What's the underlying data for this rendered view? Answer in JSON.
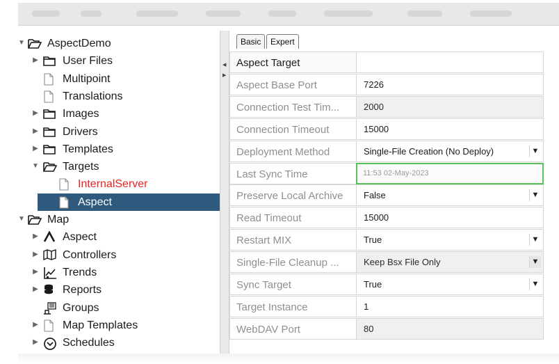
{
  "tree": {
    "items": [
      {
        "label": "AspectDemo",
        "icon": "folder-open-icon",
        "arrow": "expanded",
        "selected": false,
        "red": false
      },
      {
        "label": "User Files",
        "icon": "folder-icon",
        "arrow": "collapsed",
        "selected": false,
        "red": false
      },
      {
        "label": "Multipoint",
        "icon": "file-icon",
        "arrow": "none",
        "selected": false,
        "red": false
      },
      {
        "label": "Translations",
        "icon": "file-icon",
        "arrow": "none",
        "selected": false,
        "red": false
      },
      {
        "label": "Images",
        "icon": "folder-icon",
        "arrow": "collapsed",
        "selected": false,
        "red": false
      },
      {
        "label": "Drivers",
        "icon": "folder-icon",
        "arrow": "collapsed",
        "selected": false,
        "red": false
      },
      {
        "label": "Templates",
        "icon": "folder-icon",
        "arrow": "collapsed",
        "selected": false,
        "red": false
      },
      {
        "label": "Targets",
        "icon": "folder-open-icon",
        "arrow": "expanded",
        "selected": false,
        "red": false
      },
      {
        "label": "InternalServer",
        "icon": "file-icon",
        "arrow": "none",
        "selected": false,
        "red": true
      },
      {
        "label": "Aspect",
        "icon": "file-icon",
        "arrow": "none",
        "selected": true,
        "red": false
      },
      {
        "label": "Map",
        "icon": "folder-open-icon",
        "arrow": "expanded",
        "selected": false,
        "red": false
      },
      {
        "label": "Aspect",
        "icon": "aspect-logo-icon",
        "arrow": "collapsed",
        "selected": false,
        "red": false
      },
      {
        "label": "Controllers",
        "icon": "map-icon",
        "arrow": "collapsed",
        "selected": false,
        "red": false
      },
      {
        "label": "Trends",
        "icon": "trend-chart-icon",
        "arrow": "collapsed",
        "selected": false,
        "red": false
      },
      {
        "label": "Reports",
        "icon": "database-icon",
        "arrow": "collapsed",
        "selected": false,
        "red": false
      },
      {
        "label": "Groups",
        "icon": "groups-icon",
        "arrow": "none",
        "selected": false,
        "red": false
      },
      {
        "label": "Map Templates",
        "icon": "file-icon",
        "arrow": "collapsed",
        "selected": false,
        "red": false
      },
      {
        "label": "Schedules",
        "icon": "clock-icon",
        "arrow": "collapsed",
        "selected": false,
        "red": false
      }
    ]
  },
  "tabs": [
    {
      "label": "Basic",
      "active": false
    },
    {
      "label": "Expert",
      "active": true
    }
  ],
  "properties": {
    "header": {
      "name": "Aspect Target",
      "value": ""
    },
    "rows": [
      {
        "name": "Aspect Base Port",
        "value": "7226",
        "type": "text"
      },
      {
        "name": "Connection Test Tim...",
        "value": "2000",
        "type": "readonly"
      },
      {
        "name": "Connection Timeout",
        "value": "15000",
        "type": "text"
      },
      {
        "name": "Deployment Method",
        "value": "Single-File Creation (No Deploy)",
        "type": "dropdown"
      },
      {
        "name": "Last Sync Time",
        "value": "11:53 02-May-2023",
        "type": "sync"
      },
      {
        "name": "Preserve Local Archive",
        "value": "False",
        "type": "dropdown"
      },
      {
        "name": "Read Timeout",
        "value": "15000",
        "type": "text"
      },
      {
        "name": "Restart MIX",
        "value": "True",
        "type": "dropdown"
      },
      {
        "name": "Single-File Cleanup ...",
        "value": "Keep Bsx File Only",
        "type": "dropdown-readonly"
      },
      {
        "name": "Sync Target",
        "value": "True",
        "type": "dropdown"
      },
      {
        "name": "Target Instance",
        "value": "1",
        "type": "text"
      },
      {
        "name": "WebDAV Port",
        "value": "80",
        "type": "readonly"
      }
    ]
  },
  "colors": {
    "selection": "#2f5a7d",
    "alert_text": "#ee2222",
    "sync_border": "#59c259"
  }
}
